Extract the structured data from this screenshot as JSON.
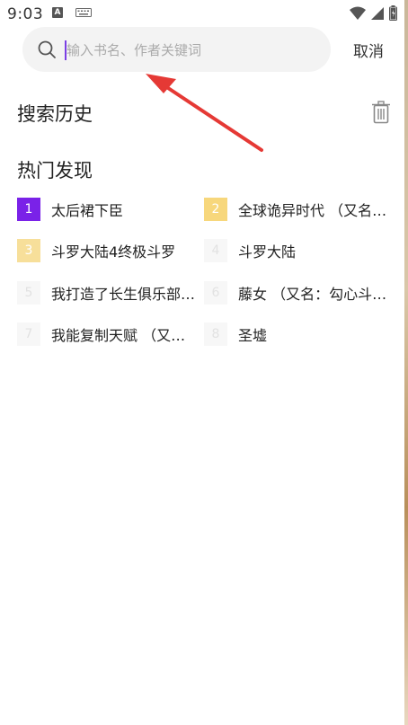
{
  "status_bar": {
    "time": "9:03",
    "icons": [
      "app-a-icon",
      "keyboard-icon",
      "wifi-icon",
      "signal-icon",
      "battery-icon"
    ]
  },
  "search": {
    "placeholder": "输入书名、作者关键词",
    "value": "",
    "cancel_label": "取消"
  },
  "history": {
    "title": "搜索历史"
  },
  "hot": {
    "title": "热门发现",
    "items": [
      {
        "rank": "1",
        "title": "太后裙下臣"
      },
      {
        "rank": "2",
        "title": "全球诡异时代 （又名…"
      },
      {
        "rank": "3",
        "title": "斗罗大陆4终极斗罗"
      },
      {
        "rank": "4",
        "title": "斗罗大陆"
      },
      {
        "rank": "5",
        "title": "我打造了长生俱乐部…"
      },
      {
        "rank": "6",
        "title": "藤女 （又名：勾心斗…"
      },
      {
        "rank": "7",
        "title": "我能复制天赋 （又名…"
      },
      {
        "rank": "8",
        "title": "圣墟"
      }
    ]
  },
  "colors": {
    "accent": "#7a22e8",
    "rank2": "#f7d77c",
    "rank3": "#f7df9a",
    "annotation_arrow": "#e53935"
  }
}
